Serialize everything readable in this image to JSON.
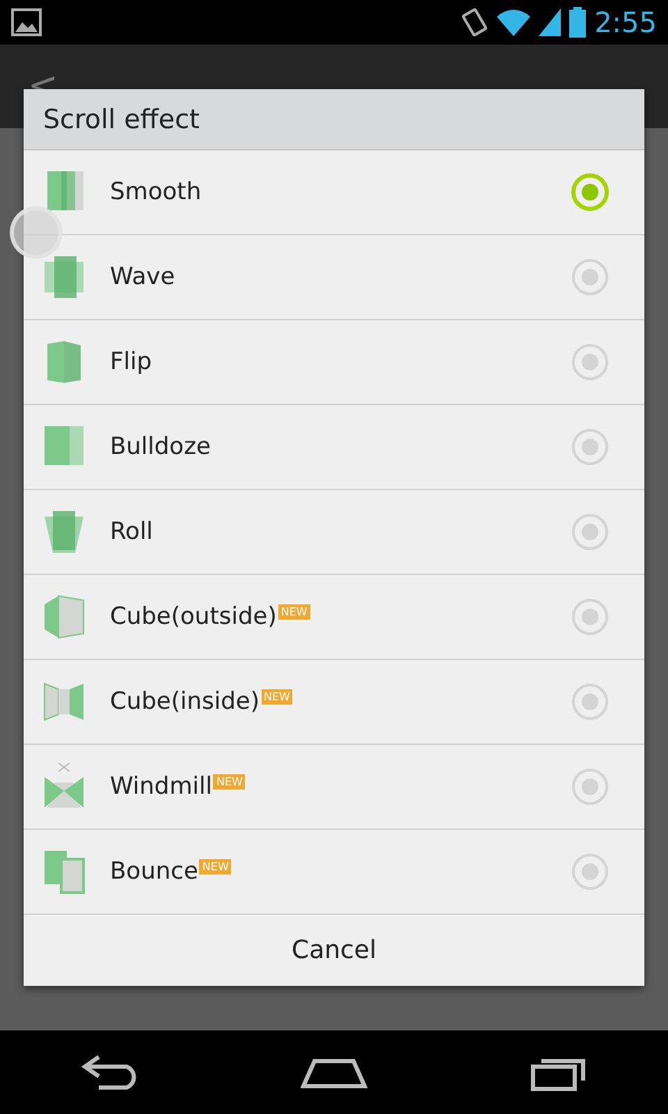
{
  "status_bar": {
    "time": "2:55"
  },
  "action_bar": {
    "back": "<"
  },
  "dialog": {
    "title": "Scroll effect",
    "options": [
      {
        "label": "Smooth",
        "selected": true
      },
      {
        "label": "Wave",
        "selected": false
      },
      {
        "label": "Flip",
        "selected": false
      },
      {
        "label": "Bulldoze",
        "selected": false
      },
      {
        "label": "Roll",
        "selected": false
      },
      {
        "label": "Cube(outside)",
        "badge": "NEW",
        "selected": false
      },
      {
        "label": "Cube(inside)",
        "badge": "NEW",
        "selected": false
      },
      {
        "label": "Windmill",
        "badge": "NEW",
        "selected": false
      },
      {
        "label": "Bounce",
        "badge": "NEW",
        "selected": false
      }
    ],
    "cancel": "Cancel"
  }
}
